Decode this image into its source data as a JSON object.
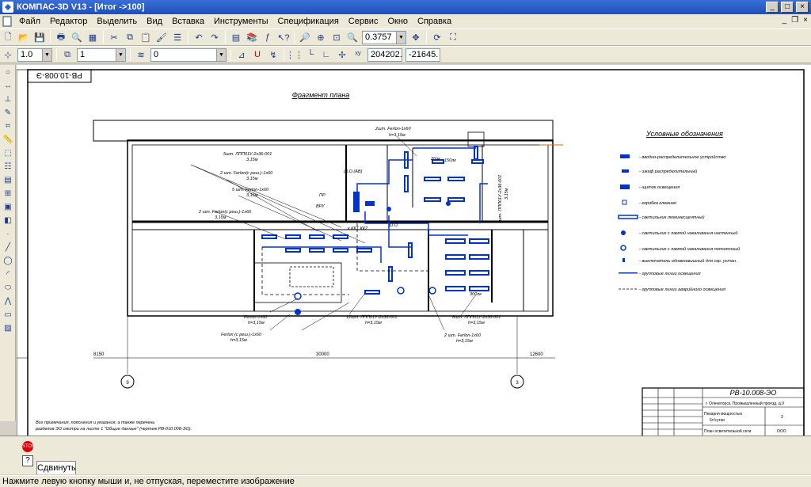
{
  "window": {
    "title": "КОМПАС-3D V13 - [Итог ->100]"
  },
  "menu": [
    "Файл",
    "Редактор",
    "Выделить",
    "Вид",
    "Вставка",
    "Инструменты",
    "Спецификация",
    "Сервис",
    "Окно",
    "Справка"
  ],
  "toolbar": {
    "zoom": "0.3757",
    "line_width": "1.0",
    "layer_num": "1",
    "style": "0",
    "coord_x": "204202.",
    "coord_y": "-21645."
  },
  "drawing": {
    "stamp_top": "РВ-10.008-Э",
    "title": "Фрагмент плана",
    "legend_title": "Условные обозначения",
    "legend_items": [
      "- вводно-распределительное устройство",
      "- шкаф распределительный",
      "- щиток освещения",
      "- коробка клемная",
      "- светильник люминесцентный",
      "- светильник с лампой накаливания настенный",
      "- светильник с лампой накаливания потолочный",
      "- выключатель однаклавишный для скр. устан.",
      "- групповые линии освещения",
      "- групповые линии аварийного освещения"
    ],
    "labels": {
      "a1": "2шт. Ferlon-1х60",
      "a1b": "h=3,15м",
      "a2": "5шт. ЛПП01У-2х36-001",
      "a2b": "3,15м",
      "a3": "2 шт. Ferlon(с реш.)-1х60",
      "a3b": "3,15м",
      "a4": "5 шт. Ferlon-1х60",
      "a4b": "3,15м",
      "a5": "2 шт. Ferlon(с реш.)-1х60",
      "a5b": "3,15м",
      "vert": "5шт. ЛПП01У-2х36-001",
      "vertb": "3,15м",
      "shoav": "Ш.О.(АВ)",
      "pr": "ПР",
      "vru": "ВРУ",
      "kkt": "к.ККТ КК2",
      "sho": "Ш.О",
      "l150": "150лк",
      "l20": "20лк",
      "l300": "300лк",
      "b1": "Ferlon-1х60",
      "b1b": "h=3,15м",
      "b2": "Ferlon (с реш.)-1х60",
      "b2b": "h=3,15м",
      "b3": "12шт. ЛПП01У-2х36-001",
      "b3b": "h=3,15м",
      "b4": "8шт. ЛПП01У-2х36-001",
      "b4b": "h=3,15м",
      "b5": "2 шт. Ferlon-1х60",
      "b5b": "h=3,15м",
      "d1": "8150",
      "d2": "30000",
      "d3": "12600",
      "axis1": "9",
      "axis2": "3",
      "note1": "Все примечания, пояснения и указания, а также перечень",
      "note2": "разделов ЭО смотри на листе 1 \"Общие данные\" (чертеж РВ-010.008-ЭО).",
      "st_code": "РВ-10.008-ЭО",
      "st_addr": "г. Оленегорск, Промышленный проезд, д.9",
      "st_name1": "Пекарня мощностью",
      "st_name2": "6т/сутки",
      "st_sheet": "3",
      "st_plan": "План осветительной сети",
      "st_org": "ООО"
    }
  },
  "property_bar": {
    "tab": "Сдвинуть"
  },
  "status": "Нажмите левую кнопку мыши и, не отпуская, переместите изображение"
}
